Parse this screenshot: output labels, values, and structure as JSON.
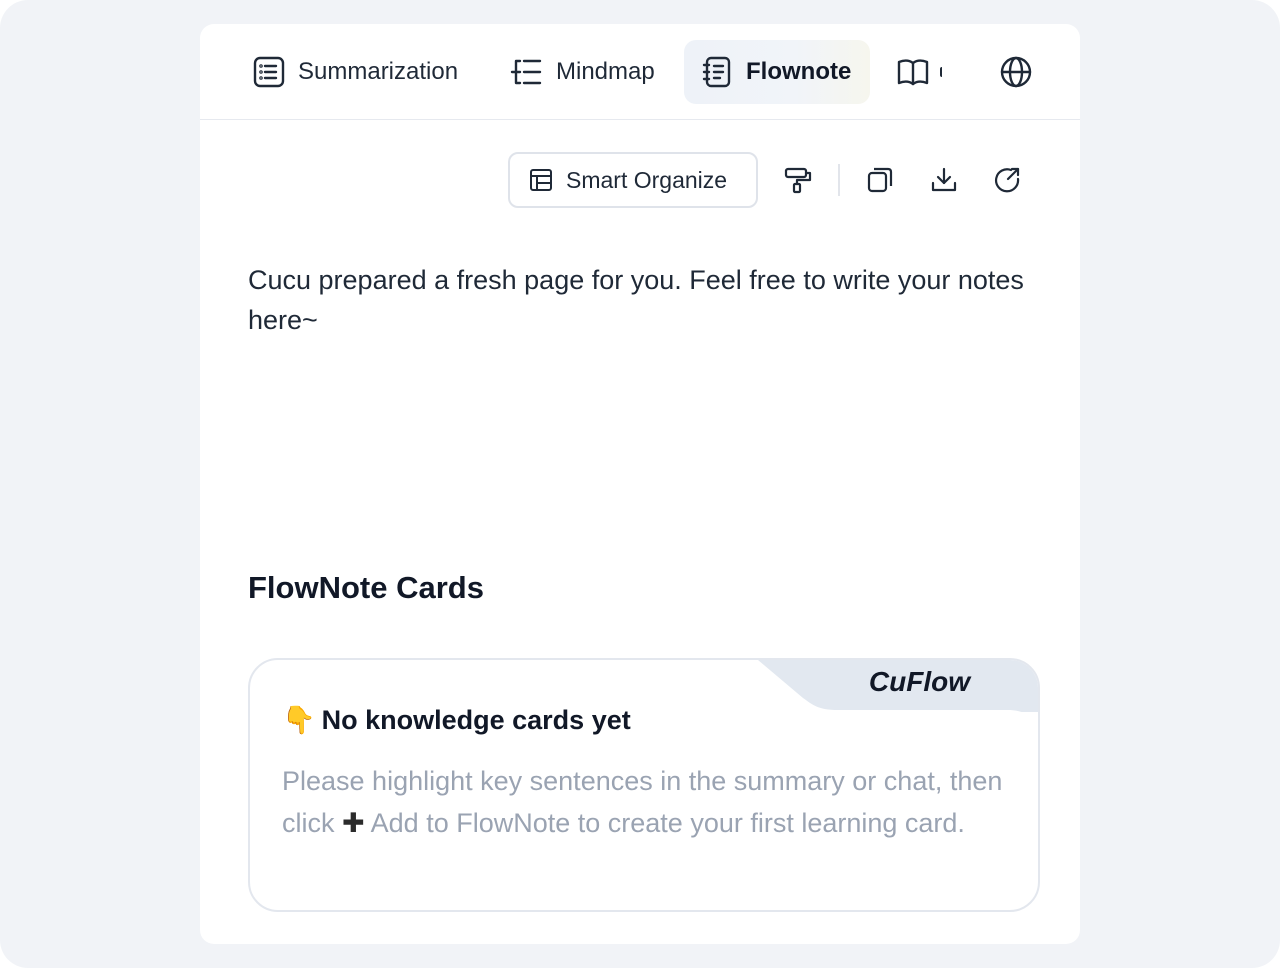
{
  "tabs": [
    {
      "label": "Summarization",
      "icon": "list-icon"
    },
    {
      "label": "Mindmap",
      "icon": "mindmap-icon"
    },
    {
      "label": "Flownote",
      "icon": "notebook-icon",
      "active": true
    },
    {
      "label": "",
      "icon": "book-icon"
    }
  ],
  "language_icon": "globe-icon",
  "toolbar": {
    "smart_organize_label": "Smart Organize",
    "icons": [
      "format-painter-icon",
      "copy-icon",
      "download-icon",
      "share-icon"
    ]
  },
  "note": {
    "text": "Cucu prepared a fresh page for you. Feel free to write your notes here~"
  },
  "cards_section": {
    "title": "FlowNote Cards",
    "card": {
      "badge": "CuFlow",
      "emoji": "👇",
      "title": "No knowledge cards yet",
      "body_before": "Please highlight key sentences in the summary or chat, then click",
      "plus_glyph": "✚",
      "body_after": " Add to FlowNote to create your first learning card."
    }
  },
  "colors": {
    "page_bg": "#f1f3f7",
    "panel_bg": "#ffffff",
    "card_badge_bg": "#e2e8f0",
    "muted_text": "#9aa3b2"
  }
}
